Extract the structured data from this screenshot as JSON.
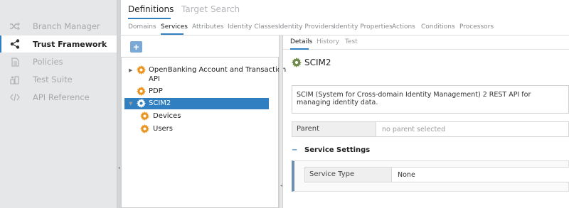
{
  "sidebar": {
    "items": [
      {
        "label": "Branch Manager",
        "icon": "shuffle-icon",
        "active": false
      },
      {
        "label": "Trust Framework",
        "icon": "share-nodes-icon",
        "active": true
      },
      {
        "label": "Policies",
        "icon": "document-icon",
        "active": false
      },
      {
        "label": "Test Suite",
        "icon": "test-suite-icon",
        "active": false
      },
      {
        "label": "API Reference",
        "icon": "code-icon",
        "active": false
      }
    ]
  },
  "top_tabs": [
    {
      "label": "Definitions",
      "active": true
    },
    {
      "label": "Target Search",
      "active": false
    }
  ],
  "sub_tabs": [
    {
      "label": "Domains",
      "active": false
    },
    {
      "label": "Services",
      "active": true
    },
    {
      "label": "Attributes",
      "active": false
    },
    {
      "label": "Identity Classes",
      "active": false
    },
    {
      "label": "Identity Providers",
      "active": false
    },
    {
      "label": "Identity Properties",
      "active": false
    },
    {
      "label": "Actions",
      "active": false
    },
    {
      "label": "Conditions",
      "active": false
    },
    {
      "label": "Processors",
      "active": false
    }
  ],
  "toolbar": {
    "add_label": "+"
  },
  "tree": {
    "items": [
      {
        "label_line1": "OpenBanking Account and Transaction",
        "label_line2": "API"
      },
      {
        "label": "PDP"
      },
      {
        "label": "SCIM2"
      },
      {
        "label": "Devices"
      },
      {
        "label": "Users"
      }
    ]
  },
  "detail_tabs": [
    {
      "label": "Details",
      "active": true
    },
    {
      "label": "History",
      "active": false
    },
    {
      "label": "Test",
      "active": false
    }
  ],
  "detail": {
    "title": "SCIM2",
    "description": "SCIM (System for Cross-domain Identity Management) 2 REST API for managing identity data.",
    "parent_label": "Parent",
    "parent_value": "no parent selected",
    "section_title": "Service Settings",
    "collapse_symbol": "−",
    "service_type_label": "Service Type",
    "service_type_value": "None"
  },
  "colors": {
    "accent": "#2f7fc1",
    "gear": "#e8941e",
    "sidebar_bg": "#e6e7e8"
  }
}
